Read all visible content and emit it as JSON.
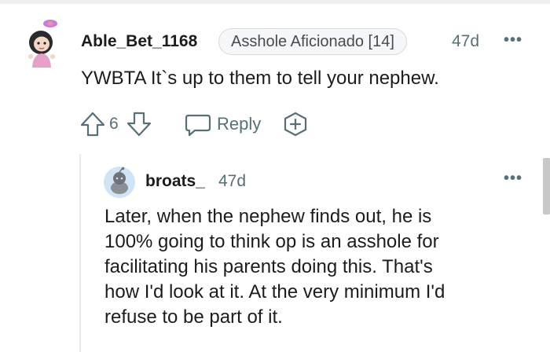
{
  "comment": {
    "username": "Able_Bet_1168",
    "flair": "Asshole Aficionado [14]",
    "age": "47d",
    "more": "•••",
    "body": "YWBTA It`s up to them to tell your nephew.",
    "votes": "6",
    "reply_label": "Reply"
  },
  "reply": {
    "username": "broats_",
    "age": "47d",
    "more": "•••",
    "lines": [
      "Later, when the nephew finds out, he is",
      "100% going to think op is an asshole for",
      "facilitating his parents doing this. That's",
      "how I'd look at it. At the very minimum I'd",
      "refuse to be part of it."
    ]
  }
}
